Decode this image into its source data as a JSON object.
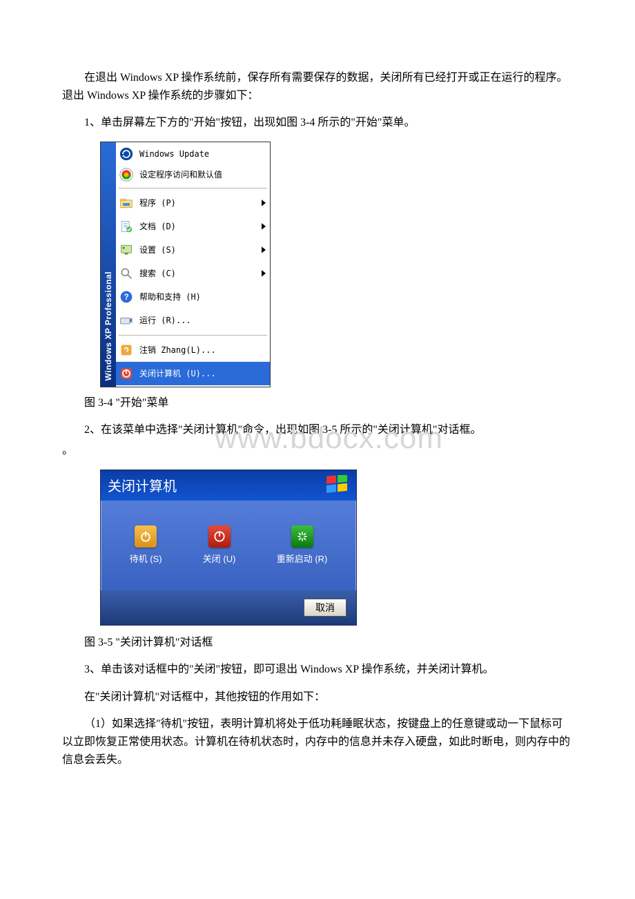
{
  "para1": "在退出 Windows XP 操作系统前，保存所有需要保存的数据，关闭所有已经打开或正在运行的程序。退出 Windows XP 操作系统的步骤如下：",
  "step1": "1、单击屏幕左下方的\"开始\"按钮，出现如图 3-4 所示的\"开始\"菜单。",
  "startmenu": {
    "side_label": "Windows XP Professional",
    "items": {
      "winupdate": "Windows Update",
      "progaccess": "设定程序访问和默认值",
      "programs": "程序 (P)",
      "docs": "文档 (D)",
      "settings": "设置 (S)",
      "search": "搜索 (C)",
      "help": "帮助和支持 (H)",
      "run": "运行 (R)...",
      "logoff": "注销 Zhang(L)...",
      "shutdown": "关闭计算机 (U)..."
    }
  },
  "caption1": "图 3-4 \"开始\"菜单",
  "watermark": "www.bdocx.com",
  "step2": "2、在该菜单中选择\"关闭计算机\"命令，出现如图 3-5 所示的\"关闭计算机\"对话框。",
  "shutdown_dialog": {
    "title": "关闭计算机",
    "standby": "待机 (S)",
    "turnoff": "关闭 (U)",
    "restart": "重新启动 (R)",
    "cancel": "取消"
  },
  "caption2": "图 3-5 \"关闭计算机\"对话框",
  "step3": "3、单击该对话框中的\"关闭\"按钮，即可退出 Windows XP 操作系统，并关闭计算机。",
  "para2": "在\"关闭计算机\"对话框中，其他按钮的作用如下：",
  "para3": "（1）如果选择\"待机\"按钮，表明计算机将处于低功耗睡眠状态，按键盘上的任意键或动一下鼠标可以立即恢复正常使用状态。计算机在待机状态时，内存中的信息并未存入硬盘，如此时断电，则内存中的信息会丢失。"
}
